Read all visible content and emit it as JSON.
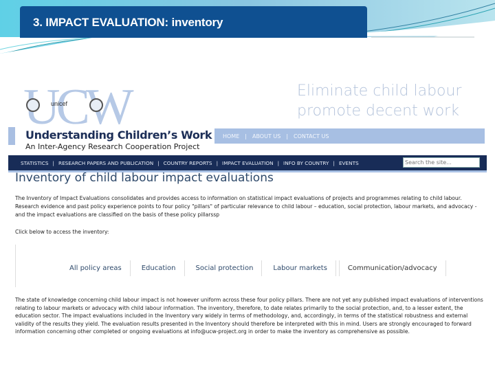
{
  "slide": {
    "title": "3. IMPACT EVALUATION: inventory"
  },
  "site": {
    "logo_text": "UCW",
    "partner_logos": [
      "ilo-emblem",
      "unicef",
      "world-bank-globe"
    ],
    "partner_unicef": "unicef",
    "tagline_line1": "Eliminate child labour",
    "tagline_line2": "promote decent work",
    "org_name": "Understanding Children’s Work",
    "org_subtitle": "An Inter-Agency Research Cooperation Project",
    "top_nav": [
      "HOME",
      "ABOUT US",
      "CONTACT US"
    ],
    "main_nav": [
      "STATISTICS",
      "RESEARCH PAPERS AND PUBLICATION",
      "COUNTRY REPORTS",
      "IMPACT EVALUATION",
      "INFO BY COUNTRY",
      "EVENTS"
    ],
    "search_placeholder": "Search the site...",
    "colors": {
      "nav_dark": "#182c57",
      "nav_light": "#a7bfe3",
      "slide_title_bg": "#0f5091"
    }
  },
  "page": {
    "title": "Inventory of child labour impact evaluations",
    "intro": "The Inventory of Impact Evaluations consolidates and provides access to information on statistical impact evaluations of projects and programmes relating to child labour. Research evidence and past policy experience points to four policy \"pillars\" of particular relevance to child labour – education, social protection, labour markets, and advocacy - and the impact evaluations are classified on the basis of these policy pillarssp",
    "click_label": "Click below to access the inventory:",
    "tabs": [
      "All policy areas",
      "Education",
      "Social protection",
      "Labour markets",
      "Communication/advocacy"
    ],
    "body": "The state of knowledge concerning child labour impact is not however uniform across these four policy pillars. There are not yet any published impact evaluations of interventions relating to labour markets or advocacy with child labour information. The inventory, therefore, to date relates primarily to the social protection, and, to a lesser extent, the education sector. The impact evaluations included in the Inventory vary widely in terms of methodology, and, accordingly, in terms of the statistical robustness and external validity of the results they yield. The evaluation results presented in the Inventory should therefore be interpreted with this in mind. Users are strongly encouraged to forward information concerning other completed or ongoing evaluations at info@ucw-project.org in order to make the inventory as comprehensive as possible."
  }
}
